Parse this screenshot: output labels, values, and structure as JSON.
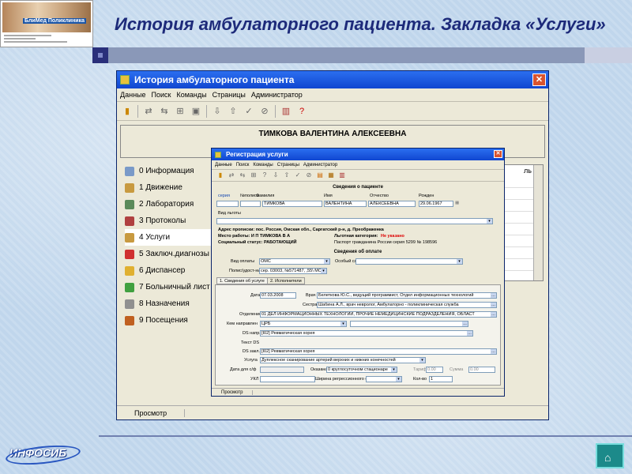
{
  "slide": {
    "title": "История амбулаторного пациента. Закладка «Услуги»",
    "thumb_text": "БлиМед Поликлиника",
    "logo_text": "ИНФОСИБ"
  },
  "main_window": {
    "title": "История амбулаторного пациента",
    "menu": [
      "Данные",
      "Поиск",
      "Команды",
      "Страницы",
      "Администратор"
    ],
    "patient_name": "ТИМКОВА ВАЛЕНТИНА АЛЕКСЕЕВНА",
    "nav": [
      {
        "label": "0 Информация",
        "color": "#7a9ac8"
      },
      {
        "label": "1 Движение",
        "color": "#c89a40"
      },
      {
        "label": "2 Лаборатория",
        "color": "#5a8a5a"
      },
      {
        "label": "3 Протоколы",
        "color": "#b04040"
      },
      {
        "label": "4 Услуги",
        "color": "#c89a40"
      },
      {
        "label": "5 Заключ.диагнозы",
        "color": "#d03030"
      },
      {
        "label": "6 Диспансер",
        "color": "#e0b030"
      },
      {
        "label": "7 Больничный лист",
        "color": "#40a040"
      },
      {
        "label": "8 Назначения",
        "color": "#909090"
      },
      {
        "label": "9 Посещения",
        "color": "#c06020"
      }
    ],
    "status_label": "Просмотр",
    "col_partial": "ль"
  },
  "dialog": {
    "title": "Регистрация услуги",
    "menu": [
      "Данные",
      "Поиск",
      "Команды",
      "Страницы",
      "Администратор"
    ],
    "patient_section": "Сведения о пациенте",
    "labels": {
      "series": "серия",
      "policy": "№полиса",
      "lastname": "Фамилия",
      "firstname": "Имя",
      "patronymic": "Отчество",
      "born": "Рожден",
      "benefit": "Вид льготы"
    },
    "values": {
      "lastname": "ТИМКОВА",
      "firstname": "ВАЛЕНТИНА",
      "patronymic": "АЛЕКСЕЕВНА",
      "born": "29.06.1967"
    },
    "address": "Адрес прописки: пос. Россия, Омская обл., Саргатский р-н, д. Преображенка",
    "work": "Место работы: И П ТИМКОВА В А",
    "social": "Социальный статус: РАБОТАЮЩИЙ",
    "benefit_cat": "Льготная категория:",
    "benefit_val": "Не указано",
    "passport": "Паспорт гражданина России серия 5299 № 198596",
    "payment_section": "Сведения об оплате",
    "payment_type_label": "Вид оплаты",
    "payment_type": "ОМС",
    "special_label": "Особый сл.",
    "policy_doc_label": "Полис/удост-ние",
    "policy_doc": "сер. 03003, №571487, ,55\\ МС",
    "tabs": [
      "1. Сведения об услуге",
      "2. Исполнители"
    ],
    "fields": {
      "date_label": "Дата",
      "date": "07.03.2008",
      "doctor_label": "Врач",
      "doctor": "Белеткова Ю.С., ведущий программист, Отдел информационных технологий",
      "nurse_label": "Сестра",
      "nurse": "Шабина А.Л., врач невролог, Амбулаторно - поликлиническая служба",
      "dept_label": "Отделение",
      "dept": "01 ДЕЛ ИНФОРМАЦИОННЫХ ТЕХНОЛОГИЙ, ПРОЧИЕ НЕМЕДИЦИНСКИЕ ПОДРАЗДЕЛЕНИЯ, ОБЛАСТ",
      "sender_label": "Кем направлен",
      "sender": "ЦРБ",
      "ds_dir_label": "DS напр.",
      "ds_dir": "[I02] Ревматическая хорея",
      "text_ds_label": "Текст DS",
      "ds_final_label": "DS закл.",
      "ds_final": "[I02] Ревматическая хорея",
      "service_label": "Услуга",
      "service": "Дуплексное сканирование артерий верхних и нижних конечностей",
      "date_sf_label": "Дата для с/ф",
      "place_label": "Оказана",
      "place": "0 круглосуточном стационаре",
      "tariff_label": "Тариф",
      "tariff": "0.00",
      "sum_label": "Сумма",
      "sum": "0.00",
      "ukl_label": "УКЛ",
      "width_label": "Ширина регрессионного окна",
      "count_label": "Кол-во",
      "count": "1"
    },
    "status_label": "Просмотр"
  }
}
